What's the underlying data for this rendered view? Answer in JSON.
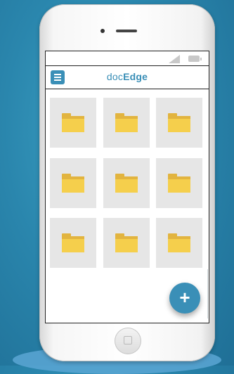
{
  "app": {
    "brand_prefix": "doc",
    "brand_suffix": "Edge"
  },
  "grid": {
    "folders": [
      {
        "name": ""
      },
      {
        "name": ""
      },
      {
        "name": ""
      },
      {
        "name": ""
      },
      {
        "name": ""
      },
      {
        "name": ""
      },
      {
        "name": ""
      },
      {
        "name": ""
      },
      {
        "name": ""
      }
    ]
  },
  "fab": {
    "label": "+"
  },
  "colors": {
    "accent": "#3a8fb7",
    "folder_front": "#f5cf4c",
    "folder_back": "#e2b43f",
    "tile_bg": "#e6e6e6"
  },
  "icons": {
    "menu": "menu-icon",
    "folder": "folder-icon",
    "add": "add-icon",
    "signal": "signal-icon",
    "battery": "battery-icon",
    "home": "home-button-icon"
  }
}
